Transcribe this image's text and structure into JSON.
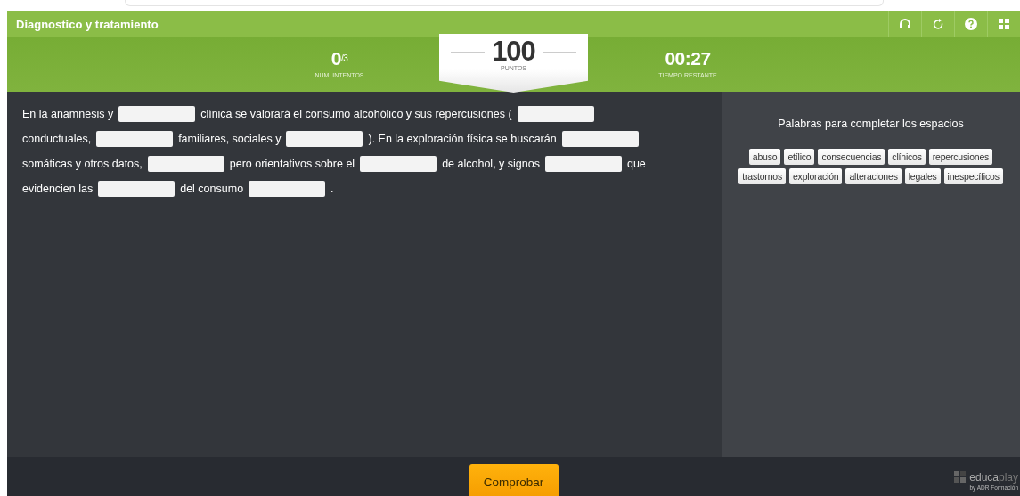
{
  "header": {
    "title": "Diagnostico y tratamiento"
  },
  "stats": {
    "attempts": {
      "value": "0",
      "total": "/3",
      "label": "NUM. INTENTOS"
    },
    "score": {
      "value": "100",
      "label": "PUNTOS"
    },
    "timer": {
      "value": "00:27",
      "label": "TIEMPO RESTANTE"
    }
  },
  "passage": [
    [
      {
        "kind": "text",
        "text": "En la anamnesis y"
      },
      {
        "kind": "blank"
      },
      {
        "kind": "text",
        "text": "clínica se valorará el consumo alcohólico y sus repercusiones ("
      },
      {
        "kind": "blank"
      }
    ],
    [
      {
        "kind": "text",
        "text": "conductuales,"
      },
      {
        "kind": "blank"
      },
      {
        "kind": "text",
        "text": "familiares, sociales y"
      },
      {
        "kind": "blank"
      },
      {
        "kind": "text",
        "text": "). En la exploración física se buscarán"
      },
      {
        "kind": "blank"
      }
    ],
    [
      {
        "kind": "text",
        "text": "somáticas y otros datos,"
      },
      {
        "kind": "blank"
      },
      {
        "kind": "text",
        "text": "pero orientativos sobre el"
      },
      {
        "kind": "blank"
      },
      {
        "kind": "text",
        "text": "de alcohol, y signos"
      },
      {
        "kind": "blank"
      },
      {
        "kind": "text",
        "text": "que"
      }
    ],
    [
      {
        "kind": "text",
        "text": "evidencien las"
      },
      {
        "kind": "blank"
      },
      {
        "kind": "text",
        "text": "del consumo"
      },
      {
        "kind": "blank"
      },
      {
        "kind": "text",
        "text": "."
      }
    ]
  ],
  "word_bank": {
    "title": "Palabras para completar los espacios",
    "words": [
      "abuso",
      "etílico",
      "consecuencias",
      "clínicos",
      "repercusiones",
      "trastornos",
      "exploración",
      "alteraciones",
      "legales",
      "inespecíficos"
    ]
  },
  "footer": {
    "button": "Comprobar",
    "logo": {
      "part_1": "educa",
      "part_2": "play",
      "byline": "by ADR Formación"
    }
  }
}
